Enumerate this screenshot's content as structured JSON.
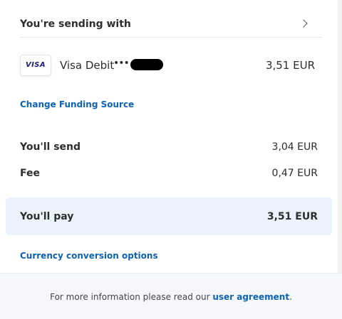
{
  "sending": {
    "title": "You're sending with"
  },
  "funding": {
    "card_brand": "VISA",
    "card_name": "Visa Debit",
    "card_mask": "•••",
    "amount": "3,51 EUR",
    "change_link": "Change Funding Source"
  },
  "summary": {
    "send_label": "You'll send",
    "send_value": "3,04 EUR",
    "fee_label": "Fee",
    "fee_value": "0,47 EUR",
    "pay_label": "You'll pay",
    "pay_value": "3,51 EUR"
  },
  "currency_link": "Currency conversion options",
  "footer": {
    "text_before": "For more information please read our ",
    "link": "user agreement",
    "text_after": "."
  },
  "colors": {
    "link": "#0c63b5",
    "pay_box": "#eaf3fb",
    "footer_bg": "#f5f7fa",
    "visa_blue": "#1a1f71"
  },
  "icons": {
    "chevron": "chevron-right-icon",
    "card": "visa-logo"
  }
}
